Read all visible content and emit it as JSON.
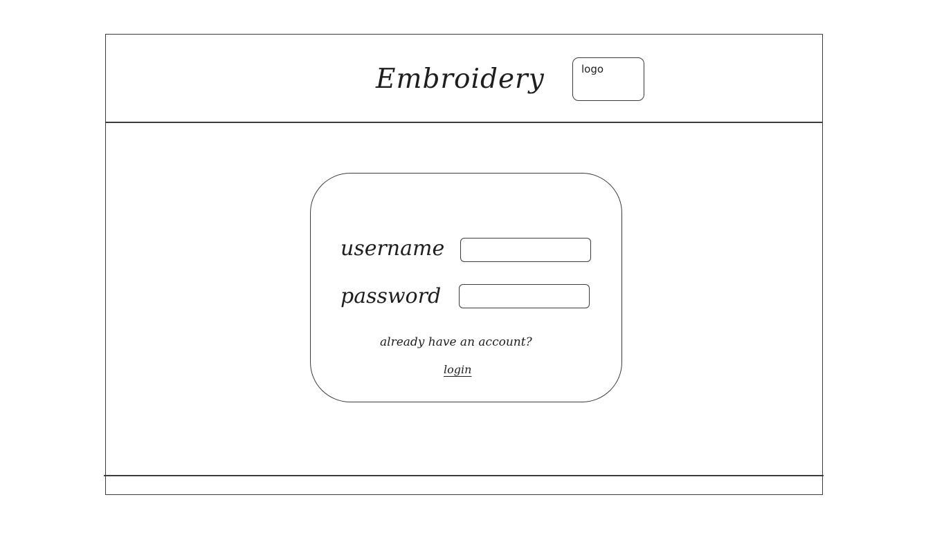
{
  "header": {
    "title": "Embroidery",
    "logo_label": "logo"
  },
  "login_form": {
    "username_label": "username",
    "password_label": "password",
    "username_value": "",
    "password_value": "",
    "account_prompt": "already have an account?",
    "login_link": "login"
  },
  "colors": {
    "stroke": "#3b3b3b",
    "text": "#1e1e1e",
    "background": "#ffffff"
  }
}
